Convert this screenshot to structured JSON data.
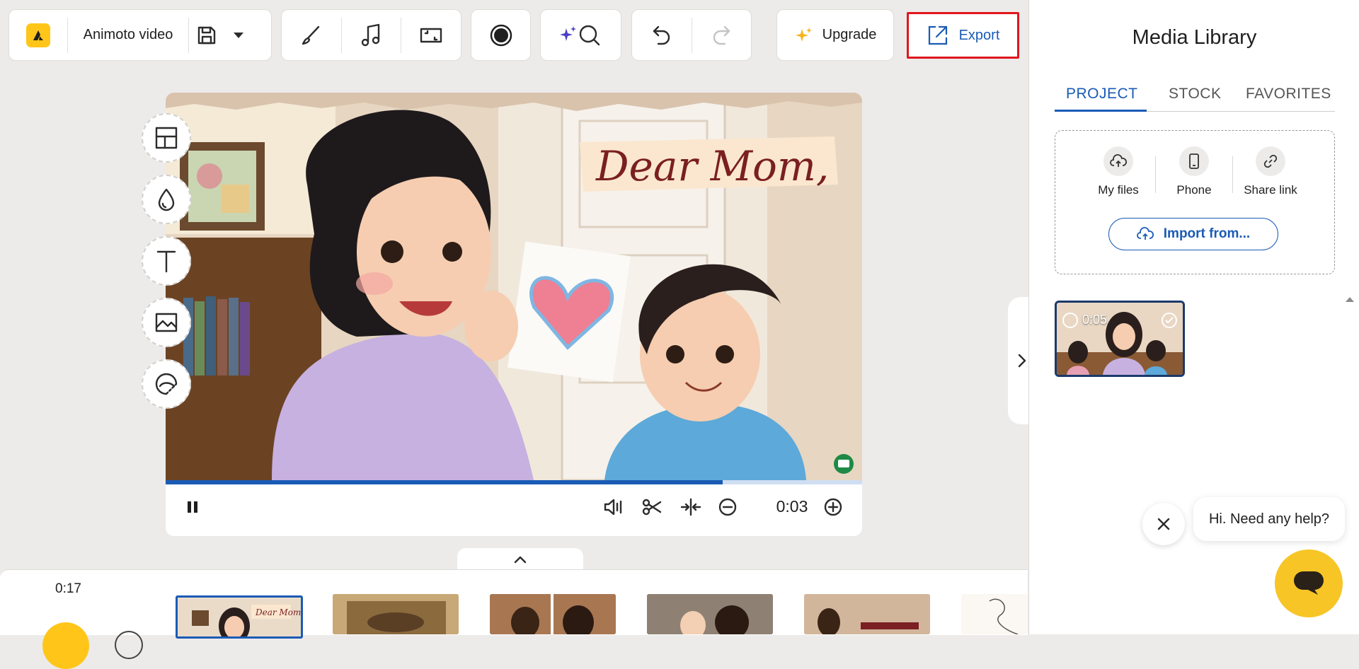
{
  "toolbar": {
    "project_title": "Animoto video",
    "upgrade_label": "Upgrade",
    "export_label": "Export",
    "icons": [
      "animoto-logo-icon",
      "save-icon",
      "caret-down-icon",
      "brush-icon",
      "music-icon",
      "resize-icon",
      "record-icon",
      "sparkle-search-icon",
      "undo-icon",
      "redo-icon",
      "sparkle-icon",
      "export-icon"
    ]
  },
  "side_tools": [
    "layout-icon",
    "color-drop-icon",
    "text-icon",
    "image-icon",
    "sticker-icon"
  ],
  "scene": {
    "overlay_text": "Dear Mom,"
  },
  "player": {
    "time": "0:03",
    "progress": 0.8
  },
  "media_library": {
    "title": "Media Library",
    "tabs": [
      "PROJECT",
      "STOCK",
      "FAVORITES"
    ],
    "active_tab": "PROJECT",
    "upload_options": [
      {
        "label": "My files",
        "icon": "cloud-upload-icon"
      },
      {
        "label": "Phone",
        "icon": "phone-icon"
      },
      {
        "label": "Share link",
        "icon": "link-icon"
      }
    ],
    "import_label": "Import from...",
    "items": [
      {
        "duration": "0:05",
        "selected": true
      }
    ]
  },
  "timeline": {
    "total_time": "0:17"
  },
  "help": {
    "message": "Hi. Need any help?"
  },
  "colors": {
    "accent": "#1a5bb5",
    "logo_yellow": "#ffc619",
    "export_highlight": "#e0161e",
    "chat_yellow": "#f7c525"
  }
}
